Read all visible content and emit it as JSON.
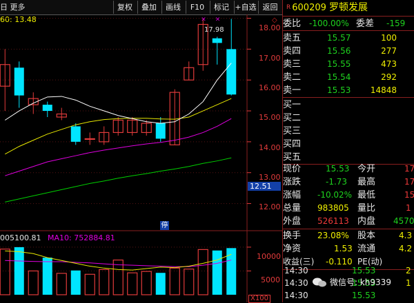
{
  "toolbar": {
    "left": "日 更多",
    "buttons": [
      "复权",
      "叠加",
      "画线",
      "F10",
      "标记",
      "+自选",
      "返回"
    ],
    "dropdown_arrow": "▶"
  },
  "chart": {
    "ma_line": "60: 13.48",
    "high_label": "17.98",
    "stop_badge": "停",
    "current_price_tag": "12.51",
    "price_axis": [
      "18.00",
      "17.00",
      "16.00",
      "15.00",
      "14.00",
      "13.00",
      "12.00"
    ],
    "vol_line": "005100.81",
    "vol_ma10": "MA10: 752884.81",
    "vol_axis": [
      "10000",
      "5000"
    ],
    "x100": "X100",
    "colors": {
      "up": "#e23b3b",
      "down": "#00e5ff",
      "ma5": "#ffffff",
      "ma10": "#e8e800",
      "ma20": "#e000e0",
      "ma60": "#00d000"
    }
  },
  "chart_data": {
    "type": "candlestick",
    "candles": [
      {
        "o": 15.8,
        "c": 16.5,
        "h": 17.0,
        "l": 15.0
      },
      {
        "o": 16.4,
        "c": 15.5,
        "h": 16.6,
        "l": 15.1
      },
      {
        "o": 15.2,
        "c": 15.4,
        "h": 15.6,
        "l": 14.9
      },
      {
        "o": 15.2,
        "c": 15.0,
        "h": 15.3,
        "l": 14.8
      },
      {
        "o": 14.8,
        "c": 14.9,
        "h": 15.1,
        "l": 14.7
      },
      {
        "o": 14.5,
        "c": 14.0,
        "h": 14.6,
        "l": 13.9
      },
      {
        "o": 14.1,
        "c": 14.1,
        "h": 14.3,
        "l": 13.9
      },
      {
        "o": 14.0,
        "c": 14.3,
        "h": 14.5,
        "l": 13.9
      },
      {
        "o": 14.3,
        "c": 14.7,
        "h": 14.8,
        "l": 14.2
      },
      {
        "o": 14.3,
        "c": 14.7,
        "h": 14.8,
        "l": 14.2
      },
      {
        "o": 14.3,
        "c": 14.6,
        "h": 14.7,
        "l": 14.2
      },
      {
        "o": 14.6,
        "c": 14.1,
        "h": 14.8,
        "l": 14.0
      },
      {
        "o": 13.9,
        "c": 15.6,
        "h": 15.7,
        "l": 13.9
      },
      {
        "o": 16.0,
        "c": 16.4,
        "h": 16.6,
        "l": 16.0
      },
      {
        "o": 16.5,
        "c": 17.8,
        "h": 17.98,
        "l": 16.3
      },
      {
        "o": 17.35,
        "c": 17.2,
        "h": 17.4,
        "l": 16.5
      },
      {
        "o": 17.0,
        "c": 15.53,
        "h": 17.98,
        "l": 15.5
      }
    ],
    "ma5": [
      14.7,
      15.0,
      15.25,
      15.45,
      15.47,
      15.35,
      15.15,
      15.0,
      14.85,
      14.75,
      14.65,
      14.6,
      14.65,
      14.9,
      15.3,
      16.0,
      16.55
    ],
    "ma10": [
      13.6,
      13.85,
      14.05,
      14.25,
      14.4,
      14.55,
      14.65,
      14.72,
      14.75,
      14.76,
      14.76,
      14.74,
      14.73,
      14.8,
      15.0,
      15.2,
      15.4
    ],
    "ma20": [
      12.9,
      13.05,
      13.2,
      13.35,
      13.45,
      13.55,
      13.65,
      13.73,
      13.8,
      13.87,
      13.93,
      13.98,
      14.05,
      14.15,
      14.3,
      14.5,
      14.75
    ],
    "ma60": [
      12.05,
      12.15,
      12.25,
      12.35,
      12.45,
      12.55,
      12.65,
      12.73,
      12.82,
      12.9,
      12.97,
      13.05,
      13.12,
      13.2,
      13.3,
      13.38,
      13.48
    ],
    "volume": [
      9600,
      10000,
      5000,
      7800,
      4500,
      5100,
      4300,
      5300,
      7300,
      4600,
      4900,
      4600,
      5600,
      5400,
      9500,
      9300,
      9800
    ],
    "vol_ma5": [
      9200,
      9050,
      8650,
      7800,
      7200,
      6600,
      6000,
      5600,
      5300,
      5200,
      5500,
      5800,
      5700,
      6000,
      6600,
      7300,
      8500
    ],
    "vol_ma10": [
      7200,
      7100,
      7000,
      6950,
      6950,
      6800,
      6700,
      6500,
      6300,
      6200,
      6100,
      6000,
      5900,
      5900,
      6200,
      6600,
      7300
    ],
    "ylim": [
      11.5,
      18.1
    ],
    "vol_ylim": [
      0,
      11000
    ]
  },
  "panel": {
    "title_r": "R",
    "code": "600209",
    "name": "罗顿发展",
    "weibi_label": "委比",
    "weibi_val": "-100.00%",
    "weicha_label": "委差",
    "weicha_val": "-159",
    "sell": [
      {
        "label": "卖五",
        "price": "15.57",
        "vol": "100"
      },
      {
        "label": "卖四",
        "price": "15.56",
        "vol": "277"
      },
      {
        "label": "卖三",
        "price": "15.55",
        "vol": "473"
      },
      {
        "label": "卖二",
        "price": "15.54",
        "vol": "292"
      },
      {
        "label": "卖一",
        "price": "15.53",
        "vol": "14848"
      }
    ],
    "buy": [
      "买一",
      "买二",
      "买三",
      "买四",
      "买五"
    ],
    "stats": [
      {
        "l1": "现价",
        "v1": "15.53",
        "l2": "今开",
        "v2": "17"
      },
      {
        "l1": "涨跌",
        "v1": "-1.73",
        "l2": "最高",
        "v2": "17"
      },
      {
        "l1": "涨幅",
        "v1": "-10.02%",
        "l2": "最低",
        "v2": "15"
      },
      {
        "l1": "总量",
        "v1": "983805",
        "l2": "量比",
        "v2": "1"
      },
      {
        "l1": "外盘",
        "v1": "526113",
        "l2": "内盘",
        "v2": "4570"
      }
    ],
    "fin": [
      {
        "l1": "换手",
        "v1": "23.08%",
        "l2": "股本",
        "v2": "4.3"
      },
      {
        "l1": "净资",
        "v1": "1.53",
        "l2": "流通",
        "v2": "4.2"
      },
      {
        "l1": "收益(三)",
        "v1": "-0.110",
        "l2": "PE(动)",
        "v2": ""
      }
    ],
    "ticks": [
      {
        "time": "14:30",
        "price": "15.53",
        "vol": "2"
      },
      {
        "time": "14:30",
        "price": "15.53",
        "vol": "1"
      },
      {
        "time": "14:30",
        "price": "15.53",
        "vol": ""
      }
    ],
    "watermark": "微信号: kh9339"
  }
}
